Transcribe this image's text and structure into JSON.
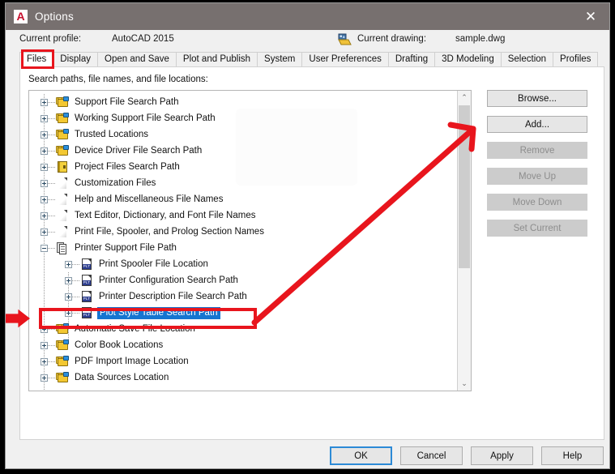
{
  "window": {
    "title": "Options",
    "logo_text": "A",
    "close_label": "✕"
  },
  "header": {
    "profile_label": "Current profile:",
    "profile_value": "AutoCAD 2015",
    "drawing_label": "Current drawing:",
    "drawing_value": "sample.dwg"
  },
  "tabs": [
    {
      "label": "Files",
      "active": true
    },
    {
      "label": "Display",
      "active": false
    },
    {
      "label": "Open and Save",
      "active": false
    },
    {
      "label": "Plot and Publish",
      "active": false
    },
    {
      "label": "System",
      "active": false
    },
    {
      "label": "User Preferences",
      "active": false
    },
    {
      "label": "Drafting",
      "active": false
    },
    {
      "label": "3D Modeling",
      "active": false
    },
    {
      "label": "Selection",
      "active": false
    },
    {
      "label": "Profiles",
      "active": false
    }
  ],
  "page": {
    "caption": "Search paths, file names, and file locations:"
  },
  "tree": {
    "items": [
      {
        "label": "Support File Search Path",
        "icon": "folder-icon",
        "indent": 0,
        "expander": "plus",
        "selected": false
      },
      {
        "label": "Working Support File Search Path",
        "icon": "folder-icon",
        "indent": 0,
        "expander": "plus",
        "selected": false
      },
      {
        "label": "Trusted Locations",
        "icon": "folder-icon",
        "indent": 0,
        "expander": "plus",
        "selected": false
      },
      {
        "label": "Device Driver File Search Path",
        "icon": "folder-icon",
        "indent": 0,
        "expander": "plus",
        "selected": false
      },
      {
        "label": "Project Files Search Path",
        "icon": "project-folder-icon",
        "indent": 0,
        "expander": "plus",
        "selected": false
      },
      {
        "label": "Customization Files",
        "icon": "page-icon",
        "indent": 0,
        "expander": "plus",
        "selected": false
      },
      {
        "label": "Help and Miscellaneous File Names",
        "icon": "page-icon",
        "indent": 0,
        "expander": "plus",
        "selected": false
      },
      {
        "label": "Text Editor, Dictionary, and Font File Names",
        "icon": "page-icon",
        "indent": 0,
        "expander": "plus",
        "selected": false
      },
      {
        "label": "Print File, Spooler, and Prolog Section Names",
        "icon": "page-icon",
        "indent": 0,
        "expander": "plus",
        "selected": false
      },
      {
        "label": "Printer Support File Path",
        "icon": "pages-stack-icon",
        "indent": 0,
        "expander": "minus",
        "selected": false
      },
      {
        "label": "Print Spooler File Location",
        "icon": "plt-file-icon",
        "indent": 1,
        "expander": "plus",
        "selected": false
      },
      {
        "label": "Printer Configuration Search Path",
        "icon": "plt-file-icon",
        "indent": 1,
        "expander": "plus",
        "selected": false
      },
      {
        "label": "Printer Description File Search Path",
        "icon": "plt-file-icon",
        "indent": 1,
        "expander": "plus",
        "selected": false
      },
      {
        "label": "Plot Style Table Search Path",
        "icon": "plt-file-icon",
        "indent": 1,
        "expander": "plus",
        "selected": true
      },
      {
        "label": "Automatic Save File Location",
        "icon": "folder-icon",
        "indent": 0,
        "expander": "plus",
        "selected": false
      },
      {
        "label": "Color Book Locations",
        "icon": "folder-icon",
        "indent": 0,
        "expander": "plus",
        "selected": false
      },
      {
        "label": "PDF Import Image Location",
        "icon": "folder-icon",
        "indent": 0,
        "expander": "plus",
        "selected": false
      },
      {
        "label": "Data Sources Location",
        "icon": "folder-icon",
        "indent": 0,
        "expander": "plus",
        "selected": false
      }
    ],
    "scroll_up_glyph": "⌃",
    "scroll_down_glyph": "⌄"
  },
  "side_buttons": [
    {
      "label": "Browse...",
      "enabled": true
    },
    {
      "label": "Add...",
      "enabled": true
    },
    {
      "label": "Remove",
      "enabled": false
    },
    {
      "label": "Move Up",
      "enabled": false
    },
    {
      "label": "Move Down",
      "enabled": false
    },
    {
      "label": "Set Current",
      "enabled": false
    }
  ],
  "bottom_buttons": [
    {
      "label": "OK",
      "default": true
    },
    {
      "label": "Cancel",
      "default": false
    },
    {
      "label": "Apply",
      "default": false
    },
    {
      "label": "Help",
      "default": false
    }
  ],
  "annotations": {
    "color": "#e8151d",
    "tab_highlight": "Files",
    "row_highlight": "Plot Style Table Search Path",
    "arrow_from": "Plot Style Table Search Path",
    "arrow_to": "Add..."
  },
  "colors": {
    "titlebar": "#77706f",
    "dialog_bg": "#f0f0f0",
    "selection": "#1675d1",
    "annotation_red": "#e8151d",
    "default_button_border": "#2c8ad6"
  }
}
